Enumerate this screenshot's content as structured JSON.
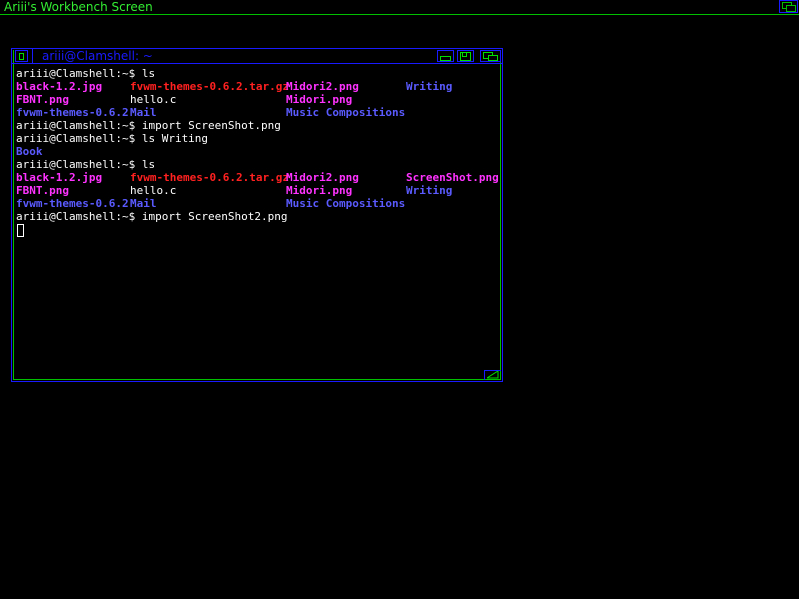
{
  "screen": {
    "title": "Ariii's Workbench Screen"
  },
  "window": {
    "title": "ariii@Clamshell: ~"
  },
  "colors": {
    "magenta": "#ff33ff",
    "red": "#ff2020",
    "blue": "#5a5aff",
    "white": "#ffffff",
    "green": "#33ee33"
  },
  "terminal": {
    "lines": [
      {
        "cells": [
          {
            "text": "ariii@Clamshell:~$ ls",
            "color": "white",
            "bold": false
          }
        ]
      },
      {
        "cells": [
          {
            "text": "black-1.2.jpg",
            "color": "magenta",
            "bold": true
          },
          {
            "text": "fvwm-themes-0.6.2.tar.gz",
            "color": "red",
            "bold": true
          },
          {
            "text": "Midori2.png",
            "color": "magenta",
            "bold": true
          },
          {
            "text": "Writing",
            "color": "blue",
            "bold": true
          }
        ]
      },
      {
        "cells": [
          {
            "text": "FBNT.png",
            "color": "magenta",
            "bold": true
          },
          {
            "text": "hello.c",
            "color": "white",
            "bold": false
          },
          {
            "text": "Midori.png",
            "color": "magenta",
            "bold": true
          }
        ]
      },
      {
        "cells": [
          {
            "text": "fvwm-themes-0.6.2",
            "color": "blue",
            "bold": true
          },
          {
            "text": "Mail",
            "color": "blue",
            "bold": true
          },
          {
            "text": "Music Compositions",
            "color": "blue",
            "bold": true
          }
        ]
      },
      {
        "cells": [
          {
            "text": "ariii@Clamshell:~$ import ScreenShot.png",
            "color": "white",
            "bold": false
          }
        ]
      },
      {
        "cells": [
          {
            "text": "ariii@Clamshell:~$ ls Writing",
            "color": "white",
            "bold": false
          }
        ]
      },
      {
        "cells": [
          {
            "text": "Book",
            "color": "blue",
            "bold": true
          }
        ]
      },
      {
        "cells": [
          {
            "text": "ariii@Clamshell:~$ ls",
            "color": "white",
            "bold": false
          }
        ]
      },
      {
        "cells": [
          {
            "text": "black-1.2.jpg",
            "color": "magenta",
            "bold": true
          },
          {
            "text": "fvwm-themes-0.6.2.tar.gz",
            "color": "red",
            "bold": true
          },
          {
            "text": "Midori2.png",
            "color": "magenta",
            "bold": true
          },
          {
            "text": "ScreenShot.png",
            "color": "magenta",
            "bold": true
          }
        ]
      },
      {
        "cells": [
          {
            "text": "FBNT.png",
            "color": "magenta",
            "bold": true
          },
          {
            "text": "hello.c",
            "color": "white",
            "bold": false
          },
          {
            "text": "Midori.png",
            "color": "magenta",
            "bold": true
          },
          {
            "text": "Writing",
            "color": "blue",
            "bold": true
          }
        ]
      },
      {
        "cells": [
          {
            "text": "fvwm-themes-0.6.2",
            "color": "blue",
            "bold": true
          },
          {
            "text": "Mail",
            "color": "blue",
            "bold": true
          },
          {
            "text": "Music Compositions",
            "color": "blue",
            "bold": true
          }
        ]
      },
      {
        "cells": [
          {
            "text": "ariii@Clamshell:~$ import ScreenShot2.png",
            "color": "white",
            "bold": false
          }
        ]
      }
    ]
  },
  "icons": {
    "close": "close-icon",
    "iconify": "iconify-icon",
    "zoom": "zoom-icon",
    "depth": "depth-icon",
    "resize": "resize-icon"
  }
}
